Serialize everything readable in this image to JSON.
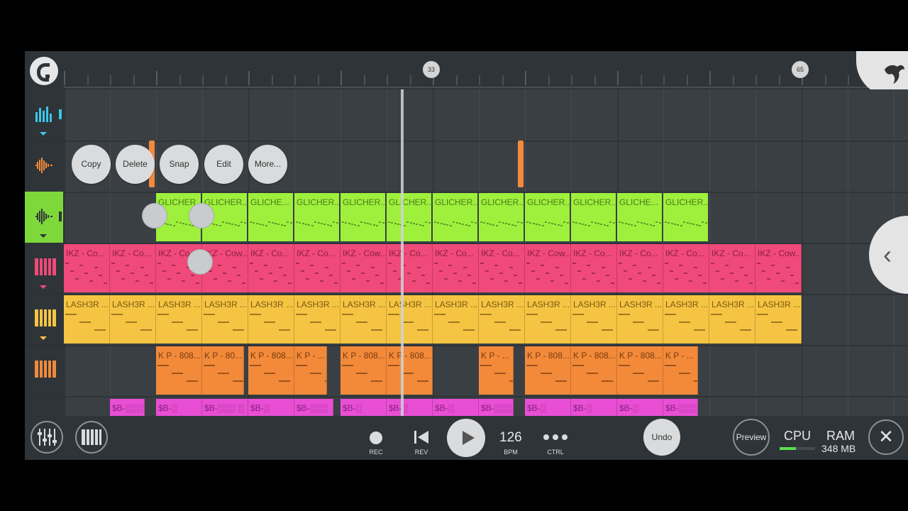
{
  "ruler": {
    "markers": [
      "33",
      "65"
    ]
  },
  "context_menu": [
    "Copy",
    "Delete",
    "Snap",
    "Edit",
    "More..."
  ],
  "tracks": [
    {
      "icon": "equalizer-icon",
      "clips": []
    },
    {
      "icon": "audio-wave-icon",
      "clips": []
    },
    {
      "icon": "audio-wave-icon",
      "active": true,
      "color": "#9ef03c",
      "clips": [
        "GLICHER...",
        "GLICHER...",
        "GLICHE...",
        "GLICHER...",
        "GLICHER...",
        "GLICHER...",
        "GLICHER...",
        "GLICHER...",
        "GLICHER...",
        "GLICHER...",
        "GLICHE...",
        "GLICHER..."
      ]
    },
    {
      "icon": "piano-keys-icon",
      "color": "#f04a7a",
      "clips": [
        "IKZ - Co...",
        "IKZ - Co...",
        "IKZ - Co...",
        "IKZ - Cow...",
        "IKZ - Co...",
        "IKZ - Co...",
        "IKZ - Cow...",
        "IKZ - Co...",
        "IKZ - Co...",
        "IKZ - Co...",
        "IKZ - Cow...",
        "IKZ - Co...",
        "IKZ - Co...",
        "IKZ - Co...",
        "IKZ - Co...",
        "IKZ - Cow..."
      ]
    },
    {
      "icon": "piano-keys-icon",
      "color": "#f5c443",
      "clips": [
        "LASH3R ...",
        "LASH3R ...",
        "LASH3R ...",
        "LASH3R ...",
        "LASH3R ...",
        "LASH3R ...",
        "LASH3R ...",
        "LASH3R ...",
        "LASH3R ...",
        "LASH3R ...",
        "LASH3R ...",
        "LASH3R ...",
        "LASH3R ...",
        "LASH3R ...",
        "LASH3R ...",
        "LASH3R ..."
      ]
    },
    {
      "icon": "piano-keys-icon",
      "color": "#f28a3a",
      "clips": [
        "K P - 808...",
        "K P - 80...",
        "K P - 808...",
        "K P - ...",
        "K P - 808...",
        "K P - 808...",
        "K P - ...",
        "K P - 808...",
        "K P - 808...",
        "K P - 808...",
        "K P - ..."
      ]
    },
    {
      "icon": "piano-keys-icon",
      "color": "#e84fd4",
      "clips": [
        "$B-░░░",
        "$B-░",
        "$B-░░░ ░",
        "$B-░",
        "$B-░░░",
        "$B-░",
        "$B-░",
        "$B-░",
        "$B-░░░",
        "$B-░",
        "$B-░",
        "$B-░",
        "$B-░░░"
      ]
    }
  ],
  "transport": {
    "rec_label": "REC",
    "rev_label": "REV",
    "bpm_value": "126",
    "bpm_label": "BPM",
    "ctrl_label": "CTRL",
    "undo_label": "Undo",
    "preview_label": "Preview",
    "cpu_label": "CPU",
    "cpu_level": 0.45,
    "ram_label": "RAM",
    "ram_value": "348 MB"
  },
  "colors": {
    "accent_green": "#7fd83a",
    "background": "#2f3439"
  }
}
